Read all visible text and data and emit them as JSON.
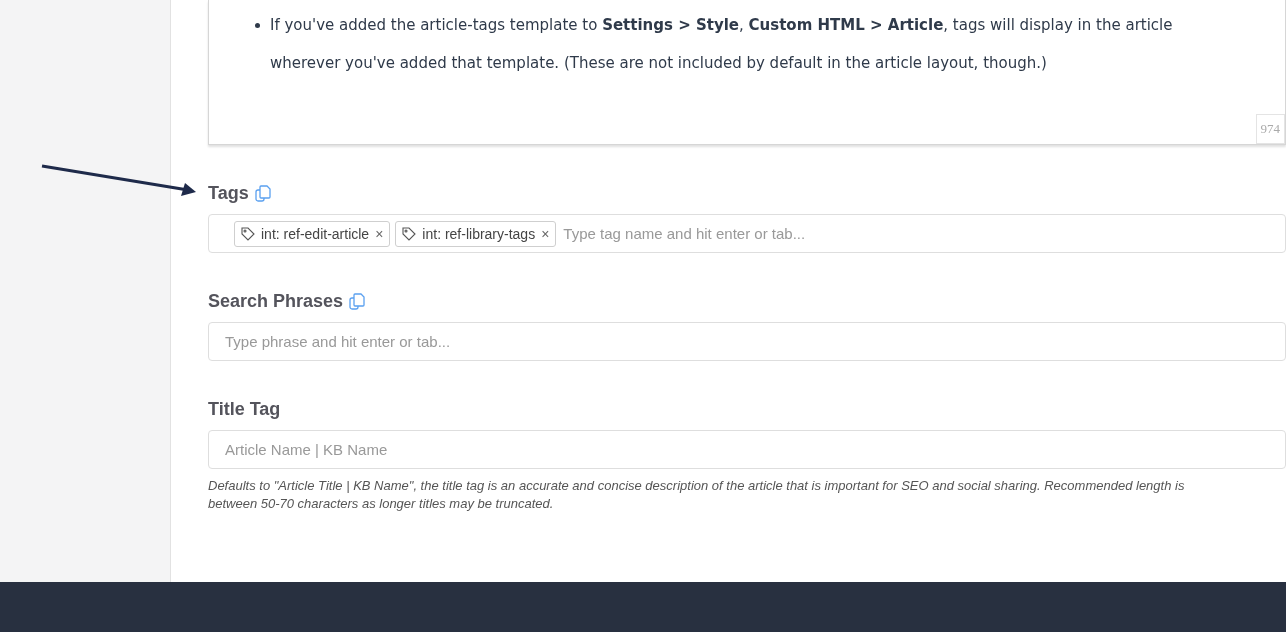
{
  "editor": {
    "bullet": "If you've added the article-tags template to **Settings > Style**, **Custom HTML > Article**, tags will display in the article wherever you've added that template. (These are not included by default in the article layout, though.)",
    "counter": "974"
  },
  "fields": [
    {
      "kind": "tags",
      "label": "Tags",
      "copy": true,
      "tags": [
        "int: ref-edit-article",
        "int: ref-library-tags"
      ],
      "remove": "×",
      "placeholder": "Type tag name and hit enter or tab..."
    },
    {
      "kind": "text",
      "label": "Search Phrases",
      "copy": true,
      "placeholder": "Type phrase and hit enter or tab..."
    },
    {
      "kind": "text",
      "label": "Title Tag",
      "copy": false,
      "placeholder": "Article Name | KB Name",
      "help": "Defaults to \"Article Title | KB Name\", the title tag is an accurate and concise description of the article that is important for SEO and social sharing. Recommended length is between 50-70 characters as longer titles may be truncated."
    }
  ]
}
